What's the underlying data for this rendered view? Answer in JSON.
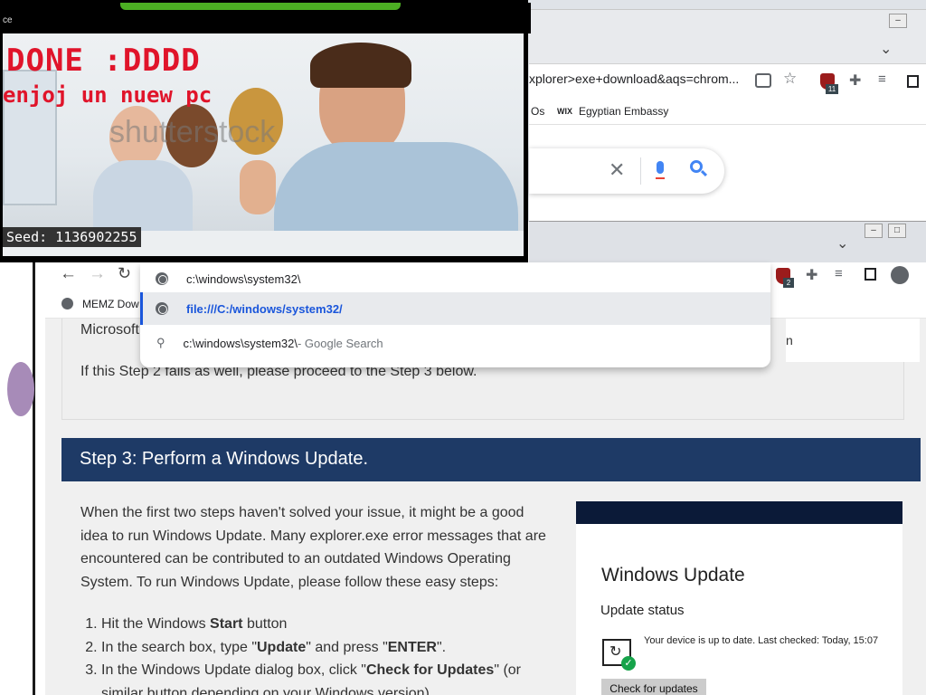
{
  "memz": {
    "title_fragment": "ce",
    "overlay_line1": "DONE :DDDD",
    "overlay_line2": "enjoj un nuew pc",
    "watermark": "shutterstock",
    "seed_label": "Seed: 1136902255"
  },
  "back_browser": {
    "address_text": "xplorer>exe+download&aqs=chrom...",
    "extension_badge": "11",
    "bookmarks": [
      {
        "label": "Os",
        "icon": "bookmark-icon"
      },
      {
        "label": "Egyptian Embassy",
        "icon": "wix-icon",
        "icon_text": "WIX"
      }
    ]
  },
  "front_browser": {
    "extension_badge": "2",
    "bookmark_first": "MEMZ Dow",
    "omnibox": {
      "typed": "c:\\windows\\system32\\",
      "suggestions": [
        {
          "text": "file:///C:/windows/system32/",
          "icon": "globe-icon",
          "selected": true
        },
        {
          "text": "c:\\windows\\system32\\",
          "suffix": " - Google Search",
          "icon": "search-icon",
          "selected": false
        }
      ]
    }
  },
  "page": {
    "partial_top": "Microsoft",
    "partial_right": "n",
    "step2_fail_text": "If this Step 2 fails as well, please proceed to the Step 3 below.",
    "step3_title": "Step 3: Perform a Windows Update.",
    "step3_intro": "When the first two steps haven't solved your issue, it might be a good idea to run Windows Update. Many explorer.exe error messages that are encountered can be contributed to an outdated Windows Operating System. To run Windows Update, please follow these easy steps:",
    "steps": [
      {
        "pre": "Hit the Windows ",
        "bold": "Start",
        "post": " button"
      },
      {
        "pre": "In the search box, type \"",
        "bold": "Update",
        "post": "\" and press \"",
        "bold2": "ENTER",
        "post2": "\"."
      },
      {
        "pre": "In the Windows Update dialog box, click \"",
        "bold": "Check for Updates",
        "post": "\" (or similar button depending on your Windows version)"
      }
    ],
    "windows_update_card": {
      "heading": "Windows Update",
      "status_heading": "Update status",
      "status_text": "Your device is up to date. Last checked: Today, 15:07",
      "button_label": "Check for updates"
    }
  },
  "colors": {
    "step_header_bg": "#1e3a66",
    "link_blue": "#1a56db",
    "memz_red": "#e0142a",
    "green_accent": "#4caf23"
  }
}
